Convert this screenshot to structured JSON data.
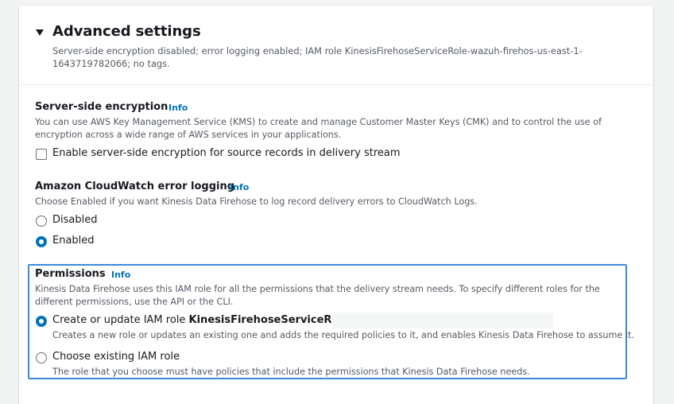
{
  "advanced": {
    "title": "Advanced settings",
    "summary": "Server-side encryption disabled; error logging enabled; IAM role KinesisFirehoseServiceRole-wazuh-firehos-us-east-1-1643719782066; no tags."
  },
  "encryption": {
    "label": "Server-side encryption",
    "info": "Info",
    "description": "You can use AWS Key Management Service (KMS) to create and manage Customer Master Keys (CMK) and to control the use of encryption across a wide range of AWS services in your applications.",
    "checkbox_label": "Enable server-side encryption for source records in delivery stream",
    "checked": false
  },
  "logging": {
    "label": "Amazon CloudWatch error logging",
    "info": "Info",
    "description": "Choose Enabled if you want Kinesis Data Firehose to log record delivery errors to CloudWatch Logs.",
    "options": [
      "Disabled",
      "Enabled"
    ],
    "selected": "Enabled"
  },
  "permissions": {
    "label": "Permissions",
    "info": "Info",
    "description": "Kinesis Data Firehose uses this IAM role for all the permissions that the delivery stream needs. To specify different roles for the different permissions, use the API or the CLI.",
    "create_prefix": "Create or update IAM role ",
    "create_role_name": "KinesisFirehoseServiceRole-",
    "create_hint": "Creates a new role or updates an existing one and adds the required policies to it, and enables Kinesis Data Firehose to assume it.",
    "existing_label": "Choose existing IAM role",
    "existing_hint": "The role that you choose must have policies that include the permissions that Kinesis Data Firehose needs.",
    "selected": "create"
  },
  "colors": {
    "accent": "#0073bb",
    "focus": "#3a8bdf",
    "text": "#16191f",
    "muted": "#545b64"
  }
}
